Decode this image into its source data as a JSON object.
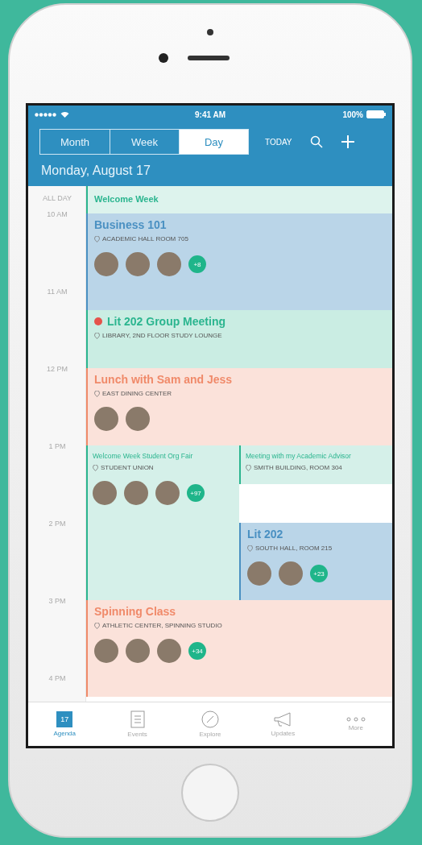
{
  "status_bar": {
    "time": "9:41 AM",
    "battery": "100%"
  },
  "view_tabs": [
    {
      "label": "Month",
      "selected": false
    },
    {
      "label": "Week",
      "selected": false
    },
    {
      "label": "Day",
      "selected": true
    }
  ],
  "today_button": "TODAY",
  "date_title": "Monday, August 17",
  "all_day": {
    "label": "ALL DAY",
    "title": "Welcome Week",
    "color": "#2bb58f"
  },
  "hours": [
    "10 AM",
    "11 AM",
    "12 PM",
    "1 PM",
    "2 PM",
    "3 PM",
    "4 PM"
  ],
  "events": [
    {
      "title": "Business 101",
      "location": "ACADEMIC HALL ROOM 705",
      "color": "#4a90c2",
      "alert": false,
      "attendees": [
        {
          "kind": "photo"
        },
        {
          "kind": "photo"
        },
        {
          "kind": "photo"
        }
      ],
      "more": "+8"
    },
    {
      "title": "Lit 202 Group Meeting",
      "location": "LIBRARY, 2ND FLOOR STUDY LOUNGE",
      "color": "#2bb58f",
      "alert": true
    },
    {
      "title": "Lunch with Sam and Jess",
      "location": "EAST DINING CENTER",
      "color": "#f08a6a",
      "alert": false,
      "attendees": [
        {
          "kind": "photo"
        },
        {
          "kind": "photo"
        }
      ]
    },
    {
      "title": "Welcome Week Student Org Fair",
      "location": "STUDENT UNION",
      "color": "#2bb58f",
      "alert": false,
      "attendees": [
        {
          "kind": "photo"
        },
        {
          "kind": "photo"
        },
        {
          "kind": "photo"
        }
      ],
      "more": "+97"
    },
    {
      "title": "Meeting with my Academic Advisor",
      "location": "SMITH BUILDING, ROOM 304",
      "color": "#2bb58f",
      "alert": false
    },
    {
      "title": "Lit 202",
      "location": "SOUTH HALL, ROOM 215",
      "color": "#4a90c2",
      "alert": false,
      "attendees": [
        {
          "kind": "photo"
        },
        {
          "kind": "photo"
        }
      ],
      "more": "+23"
    },
    {
      "title": "Spinning Class",
      "location": "ATHLETIC CENTER, SPINNING STUDIO",
      "color": "#f08a6a",
      "alert": false,
      "attendees": [
        {
          "kind": "photo"
        },
        {
          "kind": "photo"
        },
        {
          "kind": "photo"
        }
      ],
      "more": "+34"
    }
  ],
  "bottom_tabs": [
    {
      "label": "Agenda",
      "kind": "calendar",
      "icon_text": "17",
      "selected": true
    },
    {
      "label": "Events",
      "kind": "list",
      "selected": false
    },
    {
      "label": "Explore",
      "kind": "compass",
      "selected": false
    },
    {
      "label": "Updates",
      "kind": "megaphone",
      "selected": false
    },
    {
      "label": "More",
      "kind": "dots",
      "selected": false
    }
  ]
}
